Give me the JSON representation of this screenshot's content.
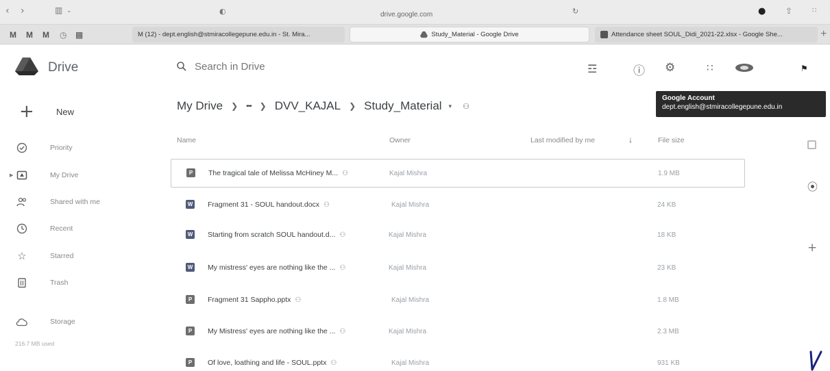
{
  "browser": {
    "url": "drive.google.com",
    "tabs": [
      "M (12) - dept.english@stmiracollegepune.edu.in - St. Mira...",
      "Study_Material - Google Drive",
      "Attendance sheet SOUL_Didi_2021-22.xlsx - Google She..."
    ],
    "pinned_tabs": [
      "M",
      "M",
      "M",
      "◷",
      "▩"
    ]
  },
  "app": {
    "name": "Drive",
    "search_placeholder": "Search in Drive"
  },
  "tooltip": {
    "title": "Google Account",
    "email": "dept.english@stmiracollegepune.edu.in"
  },
  "breadcrumb": {
    "root": "My Drive",
    "ellipsis": "•••",
    "folder": "DVV_KAJAL",
    "current": "Study_Material"
  },
  "sidebar": {
    "new_label": "New",
    "items": [
      {
        "label": "Priority",
        "icon": "priority-icon"
      },
      {
        "label": "My Drive",
        "icon": "my-drive-icon"
      },
      {
        "label": "Shared with me",
        "icon": "shared-icon"
      },
      {
        "label": "Recent",
        "icon": "clock-icon"
      },
      {
        "label": "Starred",
        "icon": "star-icon"
      },
      {
        "label": "Trash",
        "icon": "trash-icon"
      }
    ],
    "storage_label": "Storage",
    "storage_used": "216.7 MB used"
  },
  "table": {
    "headers": {
      "name": "Name",
      "owner": "Owner",
      "modified": "Last modified by me",
      "size": "File size"
    },
    "rows": [
      {
        "type": "P",
        "name": "The tragical tale of Melissa McHiney M...",
        "owner": "Kajal Mishra",
        "size": "1.9 MB"
      },
      {
        "type": "W",
        "name": "Fragment 31 - SOUL handout.docx",
        "owner": "Kajal Mishra",
        "size": "24 KB"
      },
      {
        "type": "W",
        "name": "Starting from scratch SOUL handout.d...",
        "owner": "Kajal Mishra",
        "size": "18 KB"
      },
      {
        "type": "W",
        "name": "My mistress' eyes are nothing like the ...",
        "owner": "Kajal Mishra",
        "size": "23 KB"
      },
      {
        "type": "P",
        "name": "Fragment 31 Sappho.pptx",
        "owner": "Kajal Mishra",
        "size": "1.8 MB"
      },
      {
        "type": "P",
        "name": "My Mistress' eyes are nothing like the ...",
        "owner": "Kajal Mishra",
        "size": "2.3 MB"
      },
      {
        "type": "P",
        "name": "Of love, loathing and life - SOUL.pptx",
        "owner": "Kajal Mishra",
        "size": "931 KB"
      }
    ]
  }
}
